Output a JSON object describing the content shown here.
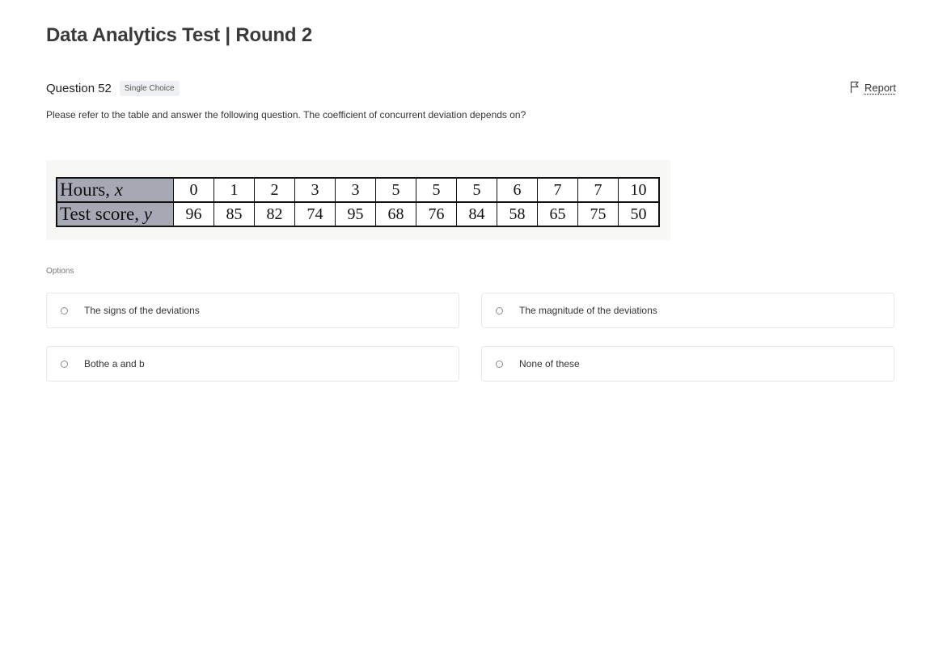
{
  "page": {
    "title": "Data Analytics Test | Round 2"
  },
  "question": {
    "number_label": "Question 52",
    "type_badge": "Single Choice",
    "report_label": "Report",
    "text": "Please refer to the table and answer the following question. The coefficient of concurrent deviation depends on?"
  },
  "table": {
    "row_x_label": "Hours, x",
    "row_y_label": "Test score, y",
    "x_values": [
      "0",
      "1",
      "2",
      "3",
      "3",
      "5",
      "5",
      "5",
      "6",
      "7",
      "7",
      "10"
    ],
    "y_values": [
      "96",
      "85",
      "82",
      "74",
      "95",
      "68",
      "76",
      "84",
      "58",
      "65",
      "75",
      "50"
    ]
  },
  "options": {
    "section_label": "Options",
    "items": [
      {
        "label": "The signs of the deviations"
      },
      {
        "label": "The magnitude of the deviations"
      },
      {
        "label": "Bothe a and b"
      },
      {
        "label": "None of these"
      }
    ]
  },
  "icons": {
    "report": "flag-icon",
    "option_marker": "radio-icon"
  },
  "colors": {
    "table_header_bg": "#a6a9b3",
    "badge_bg": "#eef0f3",
    "option_border": "#e5e7eb"
  }
}
